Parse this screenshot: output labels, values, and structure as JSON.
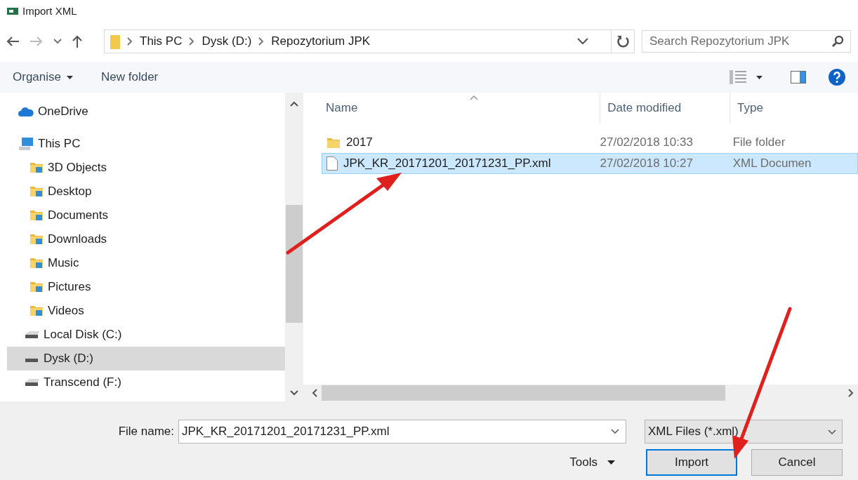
{
  "window": {
    "title": "Import XML"
  },
  "address_bar": {
    "path": [
      "This PC",
      "Dysk (D:)",
      "Repozytorium JPK"
    ]
  },
  "search": {
    "placeholder": "Search Repozytorium JPK"
  },
  "command_bar": {
    "items": [
      {
        "label": "Organise",
        "kind": "menu"
      },
      {
        "label": "New folder",
        "kind": "button"
      }
    ]
  },
  "sidebar": {
    "items": [
      {
        "label": "OneDrive",
        "kind": "cloud",
        "selected": false
      },
      {
        "label": "This PC",
        "kind": "computer",
        "selected": false,
        "children": [
          {
            "label": "3D Objects",
            "kind": "folder",
            "selected": false
          },
          {
            "label": "Desktop",
            "kind": "folder",
            "selected": false
          },
          {
            "label": "Documents",
            "kind": "folder",
            "selected": false
          },
          {
            "label": "Downloads",
            "kind": "folder",
            "selected": false
          },
          {
            "label": "Music",
            "kind": "folder",
            "selected": false
          },
          {
            "label": "Pictures",
            "kind": "folder",
            "selected": false
          },
          {
            "label": "Videos",
            "kind": "folder",
            "selected": false
          },
          {
            "label": "Local Disk (C:)",
            "kind": "drive",
            "selected": false
          },
          {
            "label": "Dysk (D:)",
            "kind": "drive",
            "selected": true
          },
          {
            "label": "Transcend (F:)",
            "kind": "drive",
            "selected": false
          }
        ]
      }
    ]
  },
  "table": {
    "columns": [
      "Name",
      "Date modified",
      "Type"
    ],
    "rows": [
      {
        "name": "2017",
        "date_modified": "27/02/2018 10:33",
        "type": "File folder",
        "kind": "folder",
        "selected": false
      },
      {
        "name": "JPK_KR_20171201_20171231_PP.xml",
        "date_modified": "27/02/2018 10:27",
        "type": "XML Documen",
        "kind": "file",
        "selected": true
      }
    ]
  },
  "footer": {
    "file_name_label": "File name:",
    "file_name": "JPK_KR_20171201_20171231_PP.xml",
    "file_type": "XML Files (*.xml)",
    "buttons": [
      {
        "label": "Tools",
        "kind": "menu"
      },
      {
        "label": "Import",
        "kind": "default"
      },
      {
        "label": "Cancel",
        "kind": "normal"
      }
    ]
  }
}
